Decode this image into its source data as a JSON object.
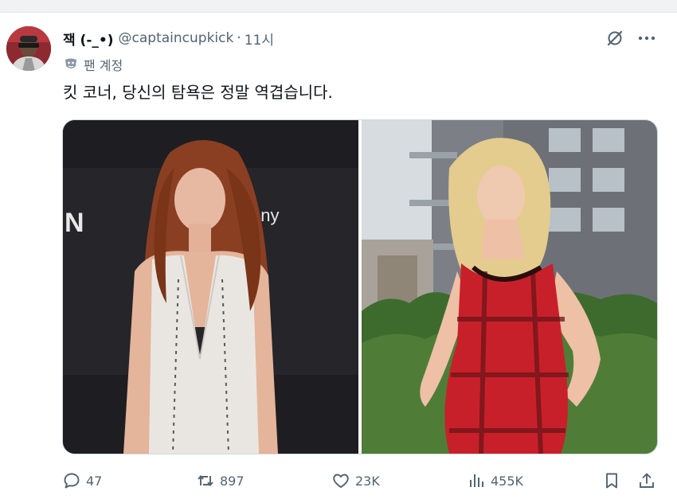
{
  "tweet": {
    "display_name": "잭 (-_•)",
    "handle": "@captaincupkick",
    "separator": "·",
    "time": "11시",
    "badge_label": "팬 계정",
    "text": "킷 코너, 당신의 탐욕은 정말 역겹습니다.",
    "photo_left_sign_text": "ony",
    "photo_left_sign_text_2": "N"
  },
  "actions": {
    "replies": "47",
    "reposts": "897",
    "likes": "23K",
    "views": "455K"
  },
  "icons": {
    "avatar": "avatar",
    "grok": "grok-icon",
    "more": "more-icon",
    "badge": "mask-icon",
    "reply": "reply-icon",
    "repost": "repost-icon",
    "like": "heart-icon",
    "views": "views-icon",
    "bookmark": "bookmark-icon",
    "share": "share-icon"
  },
  "colors": {
    "text_primary": "#0f1419",
    "text_secondary": "#536471",
    "border": "#cfd9de",
    "left_photo_bg": "#1f1f23",
    "dress_red": "#c8202a"
  }
}
